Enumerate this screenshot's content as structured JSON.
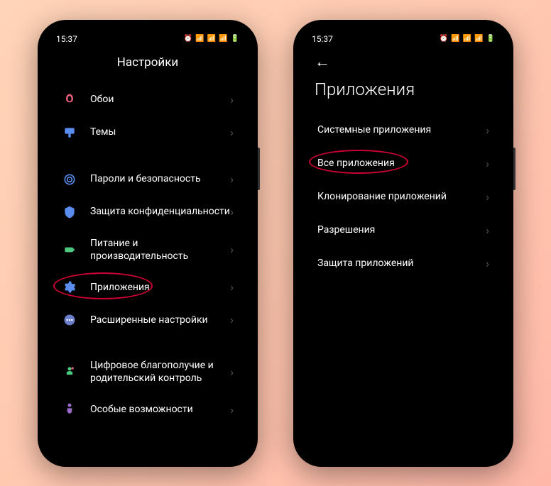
{
  "status": {
    "time": "15:37"
  },
  "phone1": {
    "title": "Настройки",
    "items": [
      {
        "label": "Обои"
      },
      {
        "label": "Темы"
      },
      {
        "label": "Пароли и безопасность"
      },
      {
        "label": "Защита конфиденциальности"
      },
      {
        "label": "Питание и производительность"
      },
      {
        "label": "Приложения"
      },
      {
        "label": "Расширенные настройки"
      },
      {
        "label": "Цифровое благополучие и родительский контроль"
      },
      {
        "label": "Особые возможности"
      }
    ]
  },
  "phone2": {
    "title": "Приложения",
    "items": [
      {
        "label": "Системные приложения"
      },
      {
        "label": "Все приложения"
      },
      {
        "label": "Клонирование приложений"
      },
      {
        "label": "Разрешения"
      },
      {
        "label": "Защита приложений"
      }
    ]
  }
}
